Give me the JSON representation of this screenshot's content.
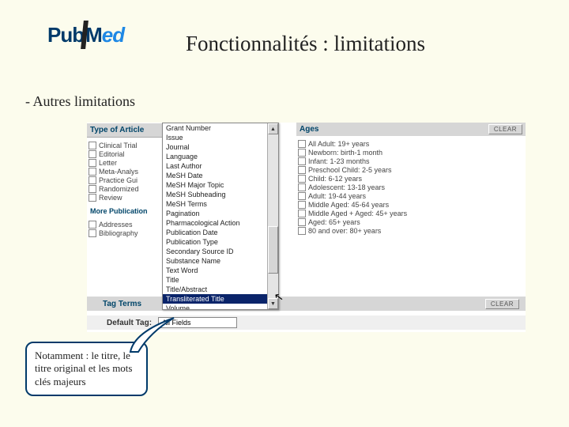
{
  "header": {
    "logo_pub": "Pub",
    "logo_med_m": "M",
    "logo_med_ed": "ed",
    "main_title": "Fonctionnalités : limitations",
    "sub_title": "- Autres limitations"
  },
  "left_panel": {
    "type_header": "Type of Article",
    "type_items": [
      "Clinical Trial",
      "Editorial",
      "Letter",
      "Meta-Analys",
      "Practice Gui",
      "Randomized",
      "Review"
    ],
    "more_pub": "More Publication",
    "more_items": [
      "Addresses",
      "Bibliography"
    ]
  },
  "dropdown": {
    "items": [
      "Grant Number",
      "Issue",
      "Journal",
      "Language",
      "Last Author",
      "MeSH Date",
      "MeSH Major Topic",
      "MeSH Subheading",
      "MeSH Terms",
      "Pagination",
      "Pharmacological Action",
      "Publication Date",
      "Publication Type",
      "Secondary Source ID",
      "Substance Name",
      "Text Word",
      "Title",
      "Title/Abstract",
      "Transliterated Title",
      "Volume"
    ],
    "highlighted_index": 18
  },
  "ages": {
    "header": "Ages",
    "clear": "CLEAR",
    "items": [
      "All Adult: 19+ years",
      "Newborn: birth-1 month",
      "Infant: 1-23 months",
      "Preschool Child: 2-5 years",
      "Child: 6-12 years",
      "Adolescent: 13-18 years",
      "Adult: 19-44 years",
      "Middle Aged: 45-64 years",
      "Middle Aged + Aged: 45+ years",
      "Aged: 65+ years",
      "80 and over: 80+ years"
    ]
  },
  "tag_terms": {
    "label": "Tag Terms",
    "clear": "CLEAR"
  },
  "default_tag": {
    "label": "Default Tag:",
    "value": "All Fields"
  },
  "callout": {
    "text": "Notamment : le titre, le titre original et les mots clés majeurs"
  },
  "scroll": {
    "up": "▲",
    "down": "▼"
  }
}
